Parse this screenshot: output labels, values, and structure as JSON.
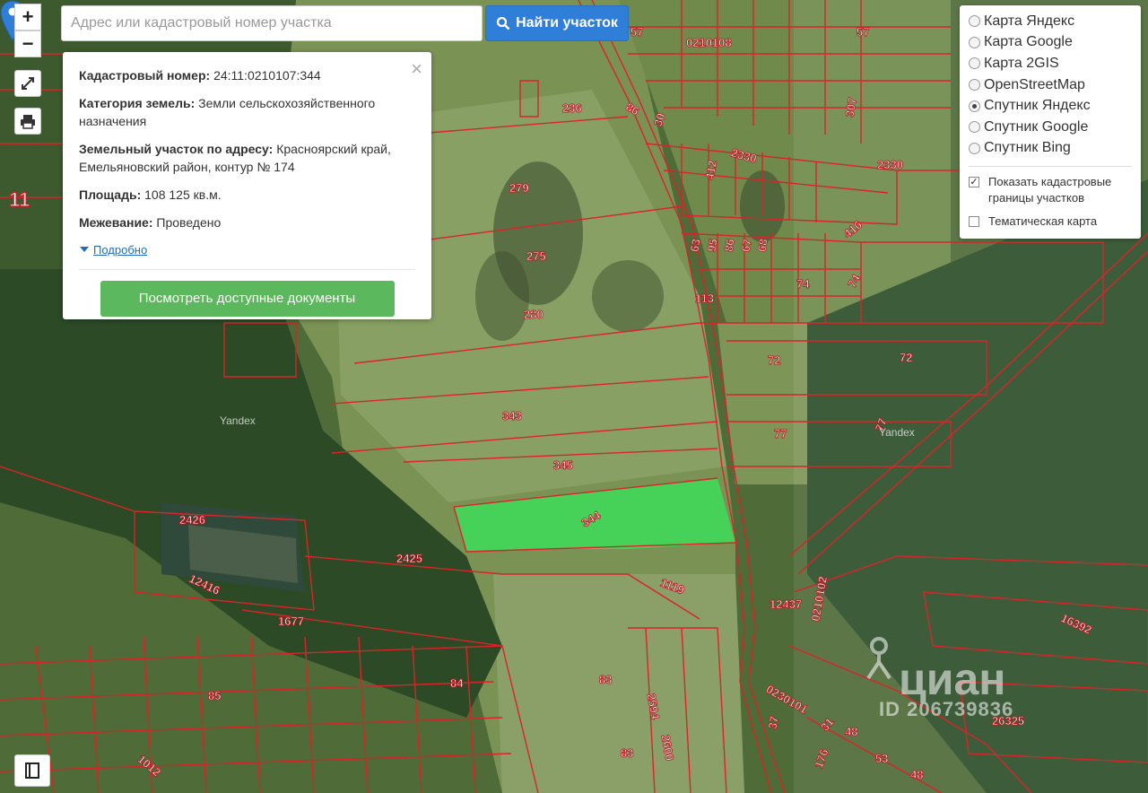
{
  "search": {
    "placeholder": "Адрес или кадастровый номер участка",
    "button_label": "Найти участок"
  },
  "controls": {
    "zoom_in": "+",
    "zoom_out": "−"
  },
  "popup": {
    "close": "×",
    "cadastral_label": "Кадастровый номер:",
    "cadastral_value": "24:11:0210107:344",
    "category_label": "Категория земель:",
    "category_value": "Земли сельскохозяйственного назначения",
    "address_label": "Земельный участок по адресу:",
    "address_value": "Красноярский край, Емельяновский район, контур № 174",
    "area_label": "Площадь:",
    "area_value": "108 125 кв.м.",
    "survey_label": "Межевание:",
    "survey_value": "Проведено",
    "details_link": "Подробно",
    "docs_button": "Посмотреть доступные документы"
  },
  "layers": {
    "options": [
      {
        "label": "Карта Яндекс",
        "selected": false
      },
      {
        "label": "Карта Google",
        "selected": false
      },
      {
        "label": "Карта 2GIS",
        "selected": false
      },
      {
        "label": "OpenStreetMap",
        "selected": false
      },
      {
        "label": "Спутник Яндекс",
        "selected": true
      },
      {
        "label": "Спутник Google",
        "selected": false
      },
      {
        "label": "Спутник Bing",
        "selected": false
      }
    ],
    "show_borders": "Показать кадастровые границы участков",
    "show_borders_checked": true,
    "thematic": "Тематическая карта",
    "thematic_checked": false
  },
  "map_labels": [
    "57",
    "0210108",
    "57",
    "236",
    "86",
    "30",
    "307",
    "2330",
    "412",
    "2330",
    "279",
    "416",
    "275",
    "63",
    "95",
    "86",
    "67",
    "68",
    "74",
    "74",
    "113",
    "280",
    "72",
    "72",
    "343",
    "77",
    "77",
    "345",
    "344",
    "2426",
    "2425",
    "12416",
    "1119",
    "12437",
    "0210102",
    "1677",
    "16392",
    "84",
    "83",
    "85",
    "2594",
    "0230101",
    "31",
    "48",
    "37",
    "176",
    "53",
    "26325",
    "48",
    "83",
    "2600",
    "1012",
    "11",
    "Yandex",
    "Yandex"
  ],
  "selected_parcel": "344",
  "watermark": {
    "brand": "циан",
    "id": "ID 206739836"
  },
  "colors": {
    "parcel_border": "#d9242a",
    "selected_parcel": "#3ddc5a",
    "accent": "#2f7ed8",
    "docs_button": "#5cb85c"
  }
}
